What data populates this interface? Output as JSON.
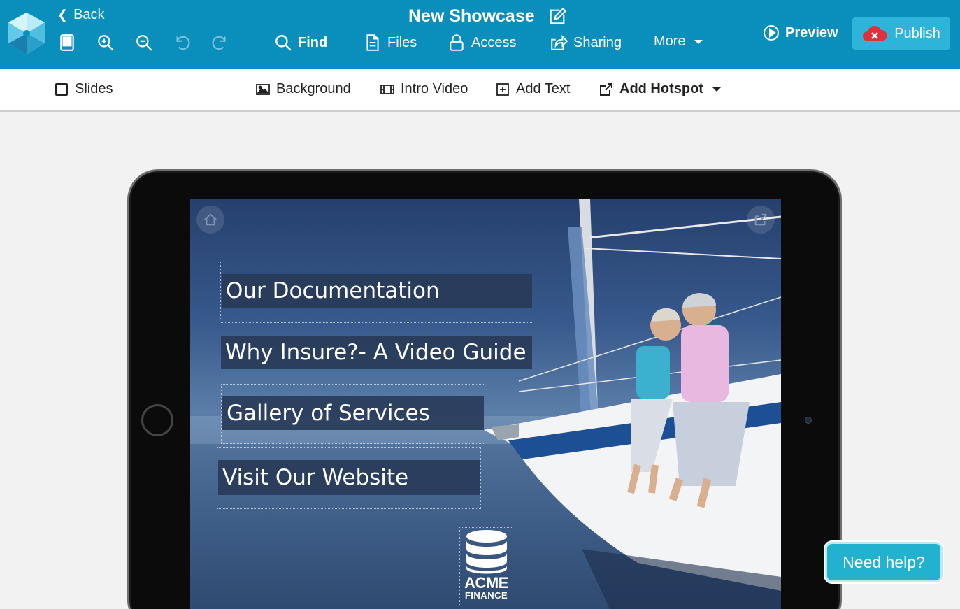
{
  "header": {
    "back_label": "Back",
    "title": "New Showcase",
    "nav": [
      {
        "label": "Find",
        "icon": "search-icon"
      },
      {
        "label": "Files",
        "icon": "file-icon"
      },
      {
        "label": "Access",
        "icon": "lock-icon"
      },
      {
        "label": "Sharing",
        "icon": "share-icon"
      },
      {
        "label": "More",
        "icon": "caret-down-icon"
      }
    ],
    "preview_label": "Preview",
    "publish_label": "Publish"
  },
  "toolbar": {
    "slides_label": "Slides",
    "background_label": "Background",
    "intro_video_label": "Intro Video",
    "add_text_label": "Add Text",
    "add_hotspot_label": "Add Hotspot"
  },
  "slide": {
    "hotspots": [
      "Our Documentation",
      "Why Insure?- A Video Guide",
      "Gallery of Services",
      "Visit Our Website"
    ],
    "logo_line1": "ACME",
    "logo_line2": "FINANCE"
  },
  "help_button_label": "Need help?",
  "colors": {
    "header_bg": "#0a8fbc",
    "publish_bg": "#2eb4d8",
    "help_bg": "#22b2cf",
    "hotspot_label_bg": "#283a58"
  }
}
